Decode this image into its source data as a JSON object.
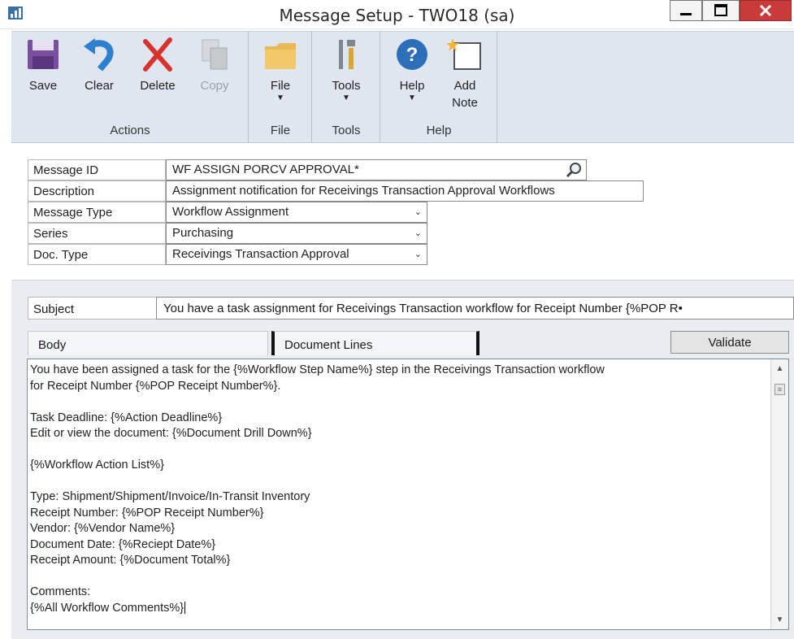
{
  "window": {
    "title": "Message Setup  -  TWO18 (sa)"
  },
  "ribbon": {
    "actions": {
      "group_label": "Actions",
      "buttons": [
        {
          "label": "Save",
          "icon": "save-icon",
          "enabled": true
        },
        {
          "label": "Clear",
          "icon": "undo-icon",
          "enabled": true
        },
        {
          "label": "Delete",
          "icon": "delete-x-icon",
          "enabled": true
        },
        {
          "label": "Copy",
          "icon": "copy-icon",
          "enabled": false
        }
      ]
    },
    "file": {
      "group_label": "File",
      "button_label": "File",
      "icon": "folder-icon"
    },
    "tools": {
      "group_label": "Tools",
      "button_label": "Tools",
      "icon": "tools-icon"
    },
    "help": {
      "group_label": "Help",
      "help_label": "Help",
      "note_label_line1": "Add",
      "note_label_line2": "Note",
      "icons": [
        "help-icon",
        "add-note-icon"
      ]
    }
  },
  "form": {
    "message_id": {
      "label": "Message ID",
      "value": "WF ASSIGN PORCV APPROVAL*"
    },
    "description": {
      "label": "Description",
      "value": "Assignment notification for Receivings Transaction Approval Workflows"
    },
    "message_type": {
      "label": "Message Type",
      "value": "Workflow Assignment"
    },
    "series": {
      "label": "Series",
      "value": "Purchasing"
    },
    "doc_type": {
      "label": "Doc. Type",
      "value": "Receivings Transaction Approval"
    }
  },
  "subject": {
    "label": "Subject",
    "value": "You have a task assignment for Receivings Transaction workflow for Receipt Number {%POP R•"
  },
  "tabs": [
    {
      "label": "Body",
      "active": true
    },
    {
      "label": "Document Lines",
      "active": false
    }
  ],
  "validate_label": "Validate",
  "body": {
    "lines": [
      "You have been assigned a task for the {%Workflow Step Name%} step in the Receivings Transaction workflow",
      "for Receipt Number {%POP Receipt Number%}.",
      "",
      "Task Deadline: {%Action Deadline%}",
      "Edit or view the document: {%Document Drill Down%}",
      "",
      "{%Workflow Action List%}",
      "",
      "Type: Shipment/Shipment/Invoice/In-Transit Inventory",
      "Receipt Number: {%POP Receipt Number%}",
      "Vendor: {%Vendor Name%}",
      "Document Date: {%Reciept Date%}",
      "Receipt Amount: {%Document Total%}",
      "",
      "Comments:",
      "{%All Workflow Comments%}"
    ]
  },
  "colors": {
    "ribbon_bg": "#dfe6ef",
    "lower_bg": "#e9edf1",
    "close_button": "#c93a3a",
    "save_icon": "#7b4fa0",
    "undo_icon": "#2f7fd0",
    "delete_icon": "#d9312b",
    "help_icon": "#2c6fb8"
  }
}
